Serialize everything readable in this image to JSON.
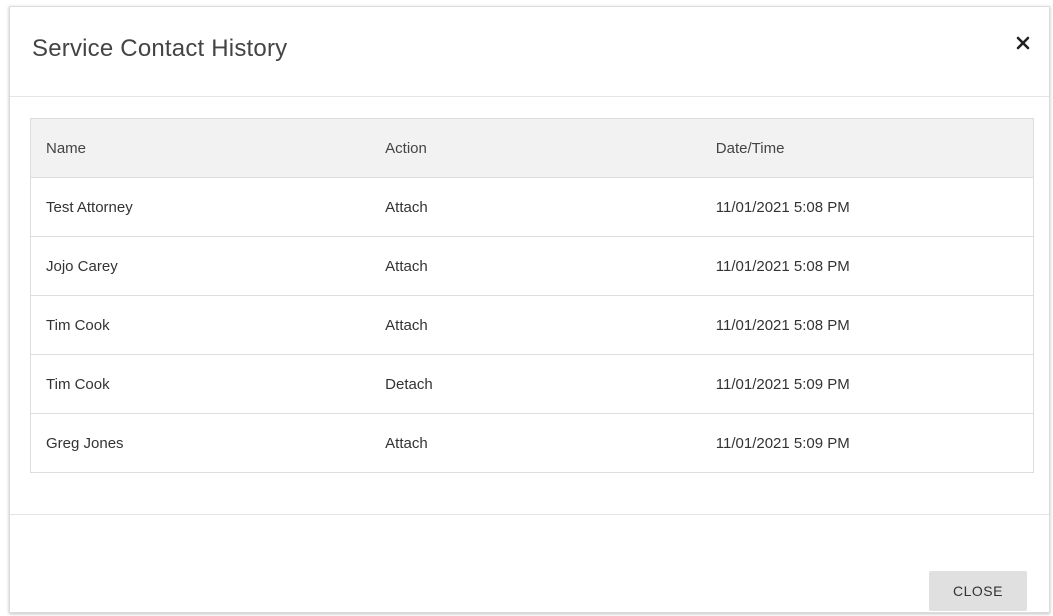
{
  "dialog": {
    "title": "Service Contact History",
    "close_icon": "close-icon"
  },
  "table": {
    "columns": [
      "Name",
      "Action",
      "Date/Time"
    ],
    "rows": [
      {
        "name": "Test Attorney",
        "action": "Attach",
        "datetime": "11/01/2021 5:08 PM"
      },
      {
        "name": "Jojo Carey",
        "action": "Attach",
        "datetime": "11/01/2021 5:08 PM"
      },
      {
        "name": "Tim Cook",
        "action": "Attach",
        "datetime": "11/01/2021 5:08 PM"
      },
      {
        "name": "Tim Cook",
        "action": "Detach",
        "datetime": "11/01/2021 5:09 PM"
      },
      {
        "name": "Greg Jones",
        "action": "Attach",
        "datetime": "11/01/2021 5:09 PM"
      }
    ]
  },
  "footer": {
    "close_label": "CLOSE"
  },
  "colors": {
    "header_row_bg": "#f2f2f2",
    "border": "#dddddd",
    "button_bg": "#e0e0e0"
  }
}
